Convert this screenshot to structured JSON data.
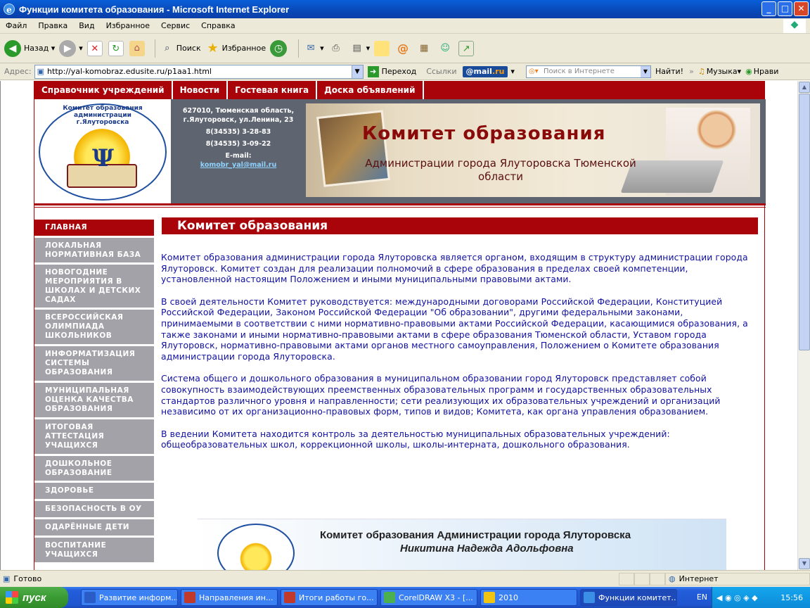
{
  "window": {
    "title": "Функции комитета образования - Microsoft Internet Explorer"
  },
  "menu": [
    "Файл",
    "Правка",
    "Вид",
    "Избранное",
    "Сервис",
    "Справка"
  ],
  "toolbar": {
    "back": "Назад",
    "search": "Поиск",
    "favorites": "Избранное"
  },
  "address": {
    "label": "Адрес:",
    "url": "http://yal-komobraz.edusite.ru/p1aa1.html",
    "go": "Переход",
    "links": "Ссылки",
    "mailru": "@mail.ru",
    "search_placeholder": "Поиск в Интернете",
    "find": "Найти!",
    "music": "Музыка",
    "like": "Нрави"
  },
  "site": {
    "topnav": [
      "Справочник учреждений",
      "Новости",
      "Гостевая книга",
      "Доска объявлений"
    ],
    "logo_arc": "Комитет образования администрации г.Ялуторовска",
    "contacts": {
      "address": "627010, Тюменская область, г.Ялуторовск, ул.Ленина, 23",
      "phone1": "8(34535) 3-28-83",
      "phone2": "8(34535) 3-09-22",
      "email_label": "E-mail:",
      "email": "komobr_yal@mail.ru"
    },
    "banner": {
      "title": "Комитет образования",
      "subtitle": "Администрации города Ялуторовска Тюменской области"
    },
    "sidebar": [
      "ГЛАВНАЯ",
      "ЛОКАЛЬНАЯ НОРМАТИВНАЯ БАЗА",
      "НОВОГОДНИЕ МЕРОПРИЯТИЯ В ШКОЛАХ И ДЕТСКИХ САДАХ",
      "ВСЕРОССИЙСКАЯ ОЛИМПИАДА ШКОЛЬНИКОВ",
      "ИНФОРМАТИЗАЦИЯ СИСТЕМЫ ОБРАЗОВАНИЯ",
      "МУНИЦИПАЛЬНАЯ ОЦЕНКА КАЧЕСТВА ОБРАЗОВАНИЯ",
      "ИТОГОВАЯ АТТЕСТАЦИЯ УЧАЩИХСЯ",
      "ДОШКОЛЬНОЕ ОБРАЗОВАНИЕ",
      "ЗДОРОВЬЕ",
      "БЕЗОПАСНОСТЬ В ОУ",
      "ОДАРЁННЫЕ ДЕТИ",
      "ВОСПИТАНИЕ УЧАЩИХСЯ"
    ],
    "heading": "Комитет образования",
    "paragraphs": [
      "Комитет образования администрации города Ялуторовска является органом, входящим в структуру администрации города Ялуторовск. Комитет создан для реализации полномочий в сфере образования в пределах своей компетенции, установленной настоящим Положением и иными муниципальными правовыми актами.",
      "В своей деятельности Комитет руководствуется: международными договорами Российской Федерации, Конституцией Российской Федерации, Законом Российской Федерации \"Об образовании\", другими федеральными законами, принимаемыми в соответствии с ними нормативно-правовыми актами Российской Федерации, касающимися образования, а также законами и иными нормативно-правовыми актами в сфере образования Тюменской области, Уставом города Ялуторовск, нормативно-правовыми актами органов местного самоуправления, Положением о Комитете образования администрации города Ялуторовска.",
      "Система общего и дошкольного образования в муниципальном образовании город Ялуторовск представляет собой совокупность взаимодействующих преемственных образовательных программ и государственных образовательных стандартов различного уровня и направленности; сети реализующих их образовательных учреждений и организаций независимо от их организационно-правовых форм, типов и видов; Комитета, как органа управления образованием.",
      "В ведении Комитета находится контроль за деятельностью муниципальных образовательных учреждений: общеобразовательных школ, коррекционной школы, школы-интерната, дошкольного образования."
    ],
    "signature": {
      "line1": "Комитет образования Администрации города Ялуторовска",
      "line2": "Никитина Надежда Адольфовна"
    }
  },
  "status": {
    "text": "Готово",
    "zone": "Интернет"
  },
  "taskbar": {
    "start": "пуск",
    "tasks": [
      {
        "label": "Развитие информ...",
        "color": "#2a5cc8"
      },
      {
        "label": "Направления ин...",
        "color": "#c0392b"
      },
      {
        "label": "Итоги работы го...",
        "color": "#c0392b"
      },
      {
        "label": "CorelDRAW X3 - [...",
        "color": "#4caf50"
      },
      {
        "label": "2010",
        "color": "#f1c40f"
      },
      {
        "label": "Функции комитет...",
        "color": "#3a8ee6"
      }
    ],
    "lang": "EN",
    "time": "15:56"
  }
}
